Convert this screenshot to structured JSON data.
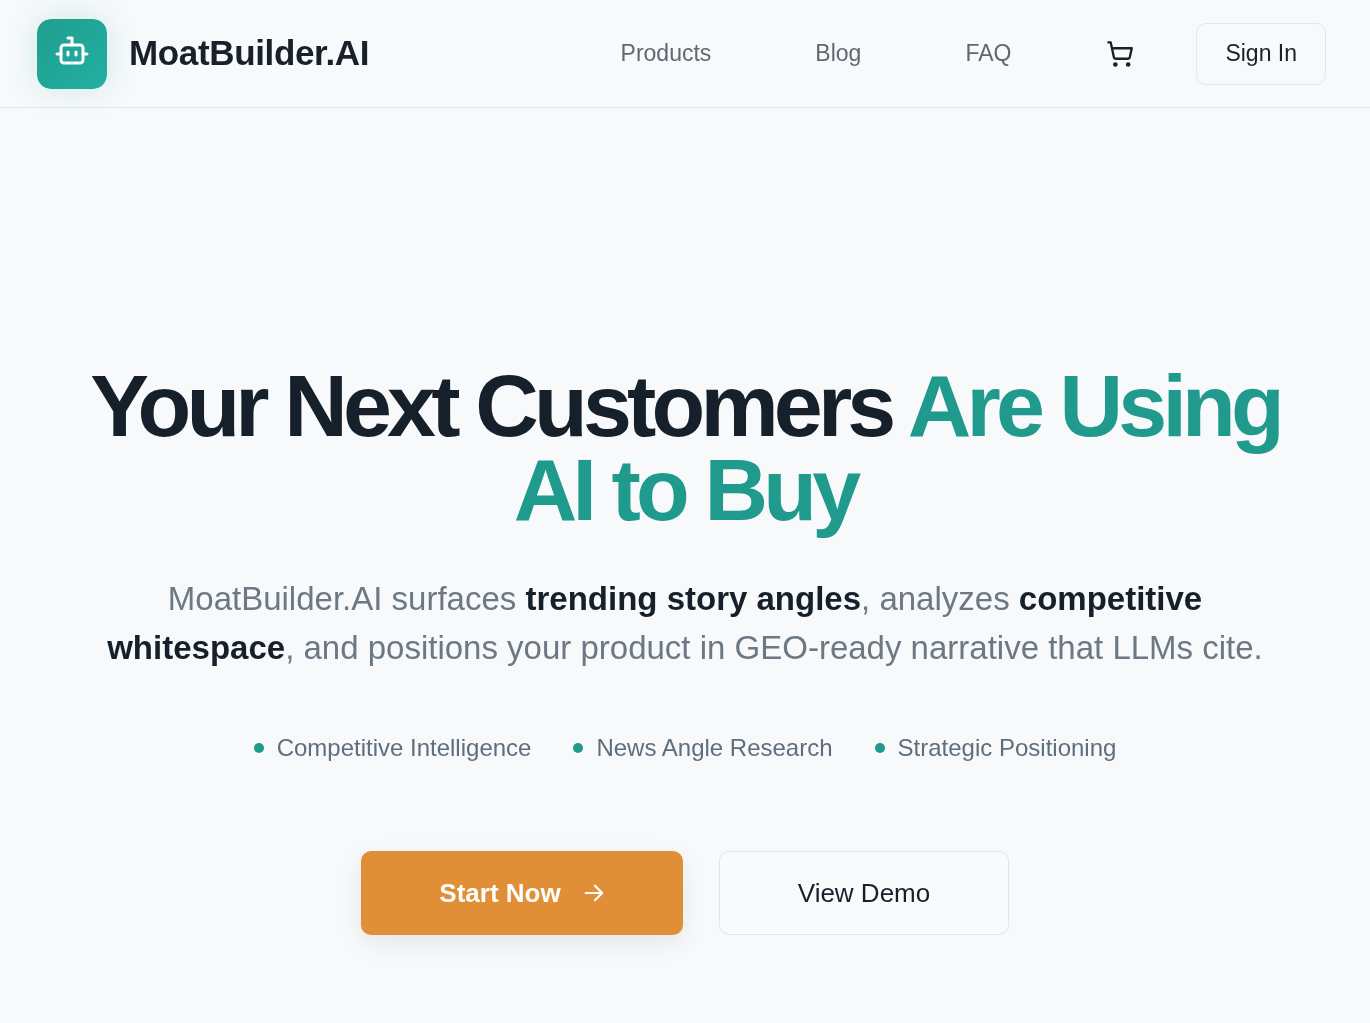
{
  "header": {
    "brand": "MoatBuilder.AI",
    "nav_links": [
      "Products",
      "Blog",
      "FAQ"
    ],
    "sign_in": "Sign In"
  },
  "hero": {
    "headline": "Your Next Customers",
    "headline_highlight": "Are Using AI to Buy",
    "subtitle": "MoatBuilder.AI surfaces **trending story angles**, analyzes **competitive whitespace**, and positions your product in GEO-ready narrative that LLMs cite.",
    "features": [
      "Competitive Intelligence",
      "News Angle Research",
      "Strategic Positioning"
    ],
    "buttons": [
      {
        "label": "Start Now",
        "kind": "primary"
      },
      {
        "label": "View Demo",
        "kind": "secondary"
      }
    ]
  }
}
